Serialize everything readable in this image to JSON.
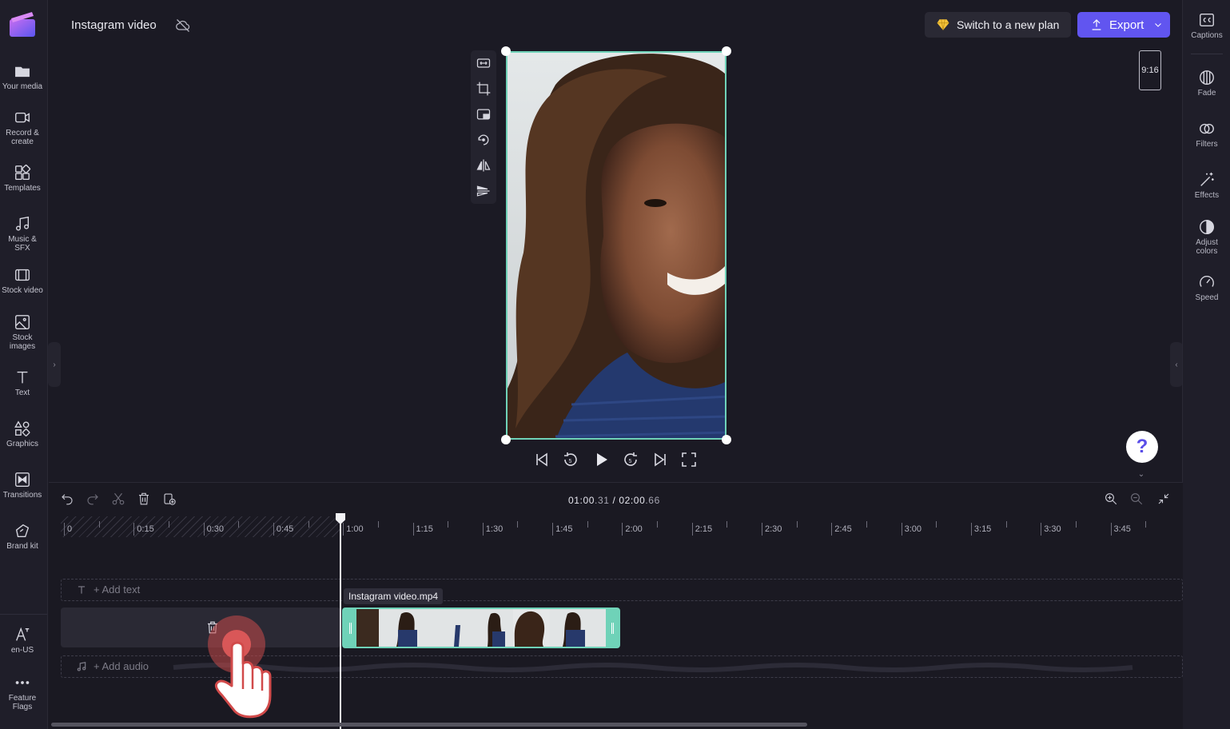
{
  "header": {
    "project_title": "Instagram video",
    "plan_label": "Switch to a new plan",
    "export_label": "Export"
  },
  "left_rail": {
    "items": [
      {
        "id": "your-media",
        "label": "Your media",
        "icon": "folder-icon"
      },
      {
        "id": "record-create",
        "label": "Record &\ncreate",
        "icon": "camera-icon"
      },
      {
        "id": "templates",
        "label": "Templates",
        "icon": "templates-icon"
      },
      {
        "id": "music-sfx",
        "label": "Music & SFX",
        "icon": "music-note-icon"
      },
      {
        "id": "stock-video",
        "label": "Stock video",
        "icon": "film-icon"
      },
      {
        "id": "stock-images",
        "label": "Stock\nimages",
        "icon": "image-icon"
      },
      {
        "id": "text",
        "label": "Text",
        "icon": "text-icon"
      },
      {
        "id": "graphics",
        "label": "Graphics",
        "icon": "shapes-icon"
      },
      {
        "id": "transitions",
        "label": "Transitions",
        "icon": "transition-icon"
      },
      {
        "id": "brand-kit",
        "label": "Brand kit",
        "icon": "brand-icon"
      }
    ],
    "bottom_items": [
      {
        "id": "language",
        "label": "en-US",
        "icon": "language-icon"
      },
      {
        "id": "feature-flags",
        "label": "Feature\nFlags",
        "icon": "more-icon"
      }
    ]
  },
  "right_rail": {
    "items": [
      {
        "id": "captions",
        "label": "Captions",
        "icon": "cc-icon"
      },
      {
        "id": "fade",
        "label": "Fade",
        "icon": "fade-icon"
      },
      {
        "id": "filters",
        "label": "Filters",
        "icon": "filters-icon"
      },
      {
        "id": "effects",
        "label": "Effects",
        "icon": "magic-wand-icon"
      },
      {
        "id": "adjust-colors",
        "label": "Adjust\ncolors",
        "icon": "contrast-icon"
      },
      {
        "id": "speed",
        "label": "Speed",
        "icon": "speedometer-icon"
      }
    ]
  },
  "preview": {
    "aspect_ratio": "9:16",
    "help_label": "?"
  },
  "timeline": {
    "current_time_main": "01:00",
    "current_time_frac": ".31",
    "separator": " / ",
    "total_time_main": "02:00",
    "total_time_frac": ".66",
    "ruler_labels": [
      "0",
      "0:15",
      "0:30",
      "0:45",
      "1:00",
      "1:15",
      "1:30",
      "1:45",
      "2:00",
      "2:15",
      "2:30",
      "2:45",
      "3:00",
      "3:15",
      "3:30",
      "3:45"
    ],
    "add_text_label": "+ Add text",
    "add_audio_label": "+ Add audio",
    "clip_name": "Instagram video.mp4"
  },
  "colors": {
    "accent": "#6155f0",
    "selection": "#6fd2b8",
    "background": "#1b1a24"
  }
}
